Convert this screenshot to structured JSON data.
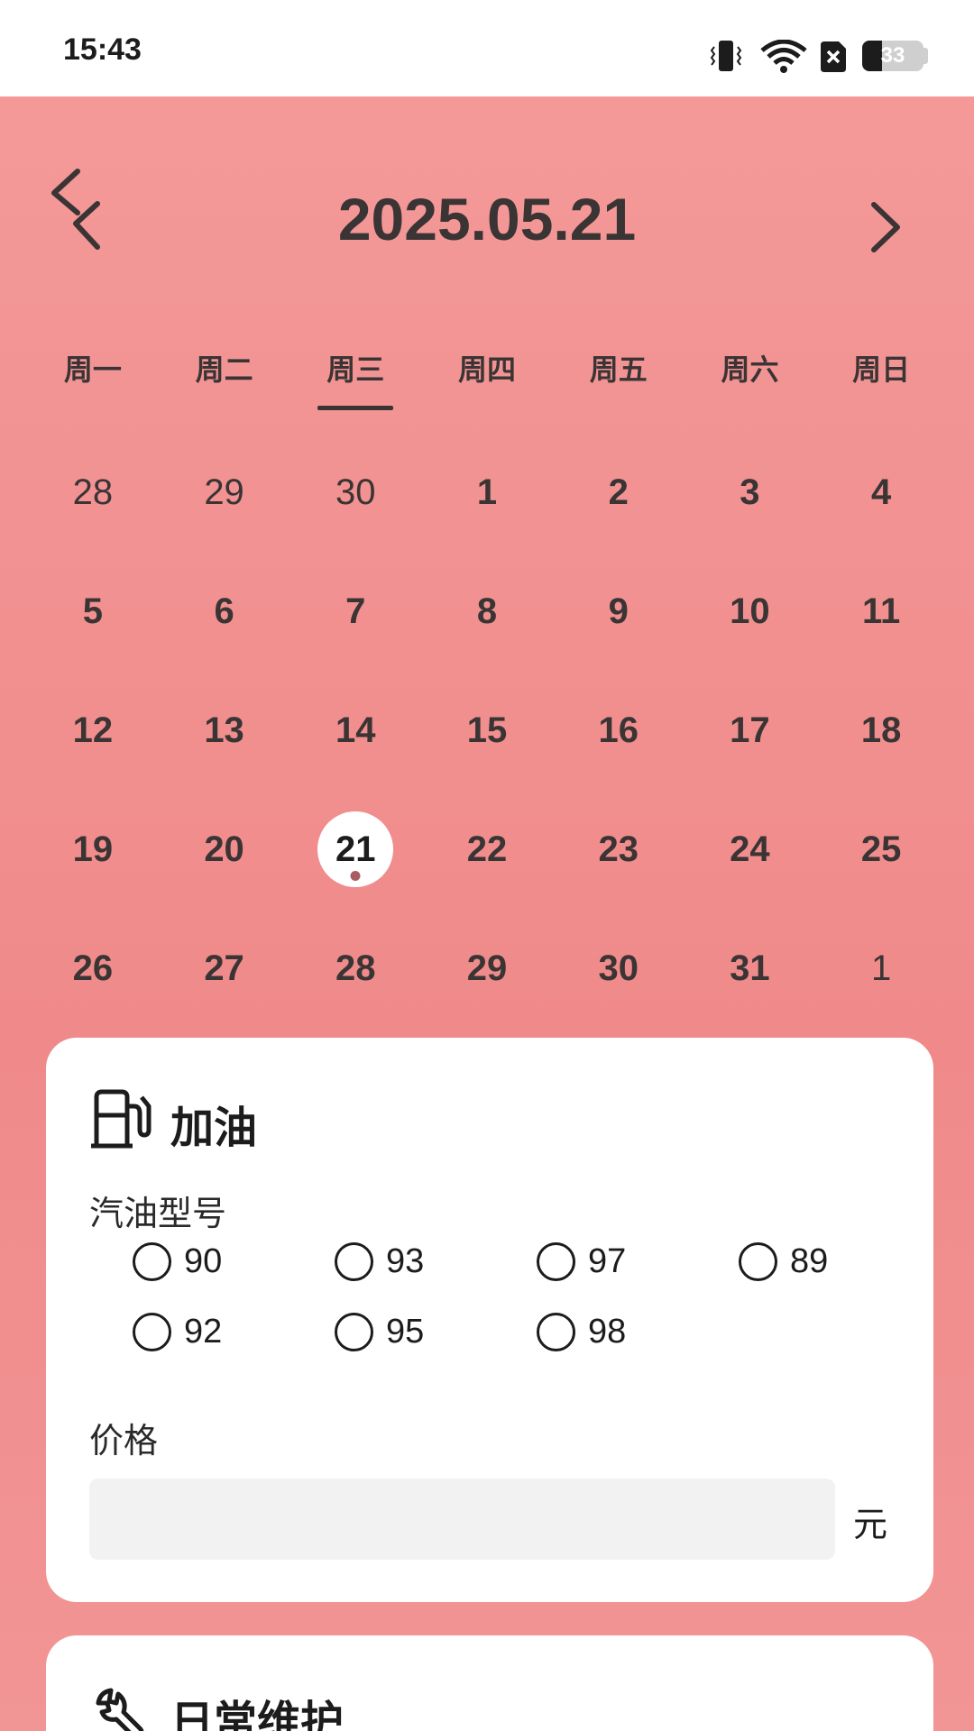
{
  "status_bar": {
    "time": "15:43",
    "battery_level": "33",
    "battery_fraction": 0.33,
    "icons": [
      "vibrate-icon",
      "wifi-icon",
      "no-sim-icon",
      "battery-icon"
    ]
  },
  "header": {
    "date": "2025.05.21",
    "prev_icon": "double-chevron-left-icon",
    "next_icon": "chevron-right-icon"
  },
  "weekdays": [
    "周一",
    "周二",
    "周三",
    "周四",
    "周五",
    "周六",
    "周日"
  ],
  "selected_weekday_index": 2,
  "days": [
    {
      "label": "28",
      "other": true
    },
    {
      "label": "29",
      "other": true
    },
    {
      "label": "30",
      "other": true
    },
    {
      "label": "1"
    },
    {
      "label": "2"
    },
    {
      "label": "3"
    },
    {
      "label": "4"
    },
    {
      "label": "5"
    },
    {
      "label": "6"
    },
    {
      "label": "7"
    },
    {
      "label": "8"
    },
    {
      "label": "9"
    },
    {
      "label": "10"
    },
    {
      "label": "11"
    },
    {
      "label": "12"
    },
    {
      "label": "13"
    },
    {
      "label": "14"
    },
    {
      "label": "15"
    },
    {
      "label": "16"
    },
    {
      "label": "17"
    },
    {
      "label": "18"
    },
    {
      "label": "19"
    },
    {
      "label": "20"
    },
    {
      "label": "21",
      "selected": true,
      "has_event": true
    },
    {
      "label": "22"
    },
    {
      "label": "23"
    },
    {
      "label": "24"
    },
    {
      "label": "25"
    },
    {
      "label": "26"
    },
    {
      "label": "27"
    },
    {
      "label": "28"
    },
    {
      "label": "29"
    },
    {
      "label": "30"
    },
    {
      "label": "31"
    },
    {
      "label": "1",
      "other": true
    }
  ],
  "fuel_card": {
    "icon": "fuel-pump-icon",
    "title": "加油",
    "fuel_type_label": "汽油型号",
    "fuel_options": [
      "90",
      "93",
      "97",
      "89",
      "92",
      "95",
      "98"
    ],
    "price_label": "价格",
    "price_value": "",
    "price_unit": "元"
  },
  "maintenance_card": {
    "icon": "wrench-icon",
    "title": "日常维护"
  },
  "colors": {
    "background_top": "#f49a9a",
    "background_bottom": "#f08a8a",
    "text_dark": "#3a3434",
    "event_dot": "#a85d62"
  }
}
